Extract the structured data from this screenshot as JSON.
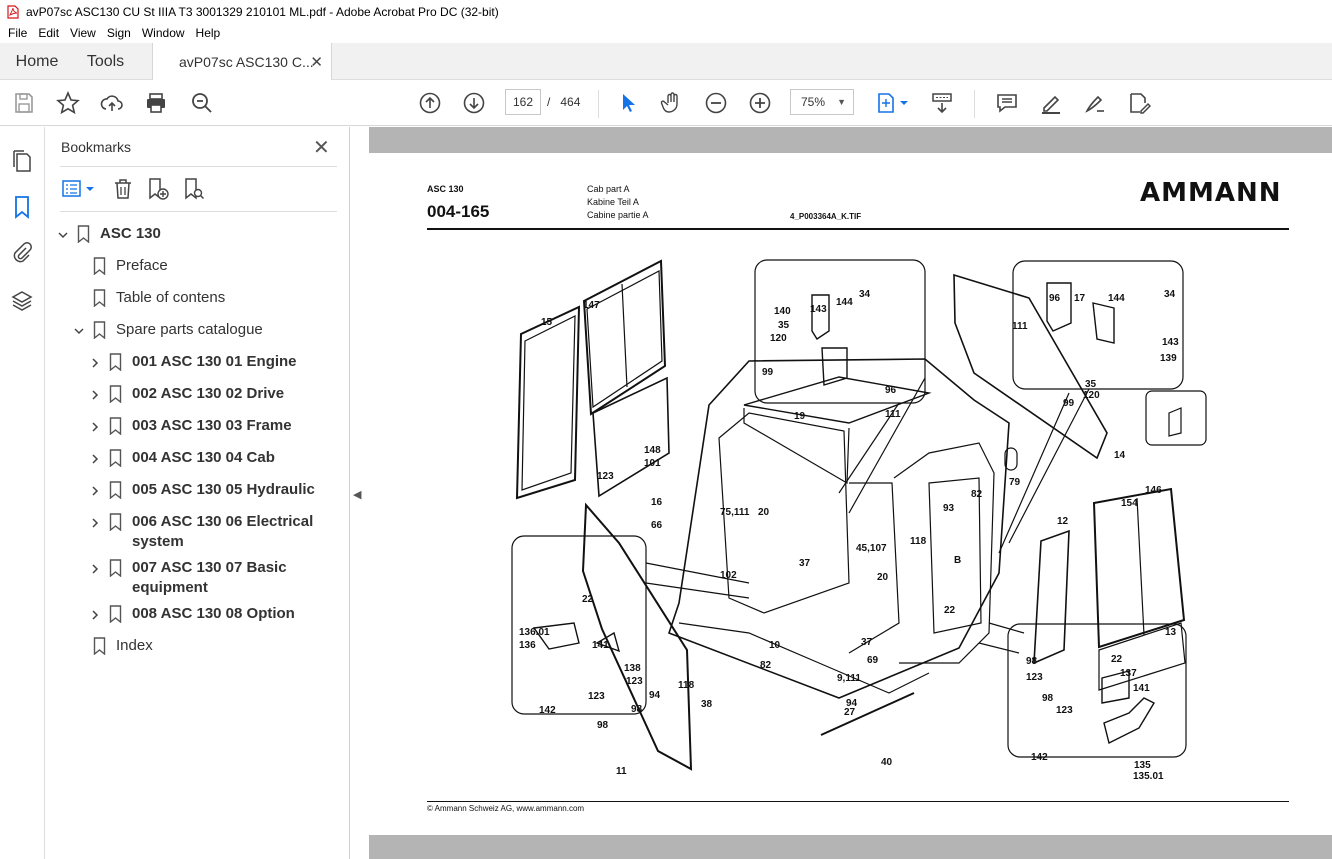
{
  "window": {
    "title": "avP07sc ASC130 CU St IIIA T3 3001329 210101 ML.pdf - Adobe Acrobat Pro DC (32-bit)"
  },
  "menu": [
    "File",
    "Edit",
    "View",
    "Sign",
    "Window",
    "Help"
  ],
  "tabs": {
    "home": "Home",
    "tools": "Tools",
    "document": "avP07sc ASC130 C..."
  },
  "toolbar": {
    "current_page": "162",
    "page_separator": "/",
    "total_pages": "464",
    "zoom": "75%"
  },
  "bookmarks": {
    "title": "Bookmarks",
    "items": [
      {
        "label": "ASC 130",
        "bold": true,
        "expanded": true
      },
      {
        "label": "Preface",
        "bold": false
      },
      {
        "label": "Table of contens",
        "bold": false
      },
      {
        "label": "Spare parts catalogue",
        "bold": false,
        "expanded": true
      },
      {
        "label": "001 ASC 130 01 Engine",
        "bold": true
      },
      {
        "label": "002 ASC 130 02 Drive",
        "bold": true
      },
      {
        "label": "003 ASC 130 03 Frame",
        "bold": true
      },
      {
        "label": "004 ASC 130 04 Cab",
        "bold": true
      },
      {
        "label": "005 ASC 130 05 Hydraulic",
        "bold": true
      },
      {
        "label": "006 ASC 130 06 Electrical",
        "label2": "system",
        "bold": true
      },
      {
        "label": "007 ASC 130 07 Basic",
        "label2": "equipment",
        "bold": true
      },
      {
        "label": "008 ASC 130 08 Option",
        "bold": true
      },
      {
        "label": "Index",
        "bold": false
      }
    ]
  },
  "document": {
    "model": "ASC 130",
    "page_number": "004-165",
    "desc_en": "Cab part A",
    "desc_de": "Kabine Teil A",
    "desc_fr": "Cabine partie A",
    "filename": "4_P003364A_K.TIF",
    "logo": "AMMANN",
    "footer": "© Ammann Schweiz AG, www.ammann.com",
    "callouts": [
      "147",
      "15",
      "148",
      "101",
      "123",
      "16",
      "66",
      "102",
      "75,111",
      "20",
      "37",
      "10",
      "45,107",
      "20",
      "37",
      "69",
      "9,111",
      "94",
      "27",
      "38",
      "40",
      "11",
      "22",
      "136.01",
      "136",
      "141",
      "138",
      "123",
      "98",
      "142",
      "123",
      "98",
      "94",
      "118",
      "82",
      "140",
      "143",
      "144",
      "34",
      "35",
      "120",
      "99",
      "96",
      "19",
      "111",
      "96",
      "17",
      "144",
      "34",
      "111",
      "143",
      "139",
      "35",
      "120",
      "99",
      "79",
      "82",
      "93",
      "118",
      "B",
      "22",
      "14",
      "146",
      "154",
      "12",
      "13",
      "98",
      "22",
      "137",
      "123",
      "98",
      "141",
      "123",
      "142",
      "135",
      "135.01"
    ]
  }
}
